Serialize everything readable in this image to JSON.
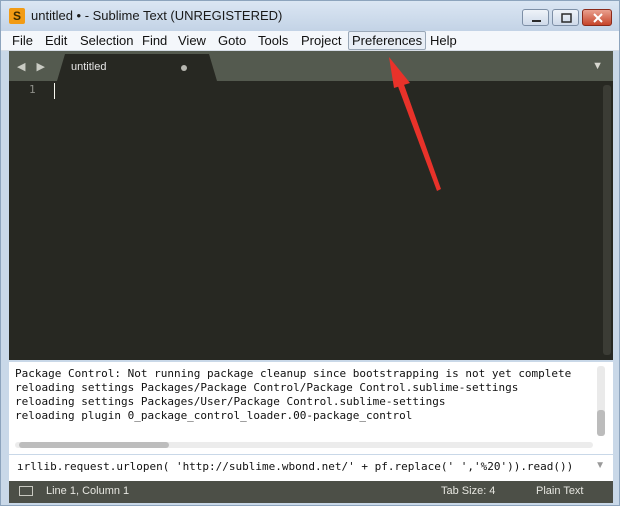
{
  "window": {
    "title": "untitled • - Sublime Text (UNREGISTERED)",
    "app_icon_letter": "S",
    "buttons": [
      "minimize-icon",
      "maximize-icon",
      "close-icon"
    ]
  },
  "menu": {
    "items": [
      "File",
      "Edit",
      "Selection",
      "Find",
      "View",
      "Goto",
      "Tools",
      "Project",
      "Preferences",
      "Help"
    ],
    "highlighted": "Preferences"
  },
  "tabs": {
    "nav_arrows": "◀ ▶",
    "active_tab_label": "untitled",
    "dropdown_icon": "▼"
  },
  "editor": {
    "line_numbers": [
      "1"
    ],
    "background": "#272822"
  },
  "console": {
    "lines": [
      "Package Control: Not running package cleanup since bootstrapping is not yet complete",
      "reloading settings Packages/Package Control/Package Control.sublime-settings",
      "reloading settings Packages/User/Package Control.sublime-settings",
      "reloading plugin 0_package_control_loader.00-package_control"
    ]
  },
  "input": {
    "value": "ırllib.request.urlopen( 'http://sublime.wbond.net/' + pf.replace(' ','%20')).read())"
  },
  "status": {
    "position": "Line 1, Column 1",
    "tab_size": "Tab Size: 4",
    "syntax": "Plain Text"
  },
  "colors": {
    "annotation_arrow": "#e8322a",
    "editor_bg": "#272822",
    "statusbar_bg": "#4c4f47"
  }
}
